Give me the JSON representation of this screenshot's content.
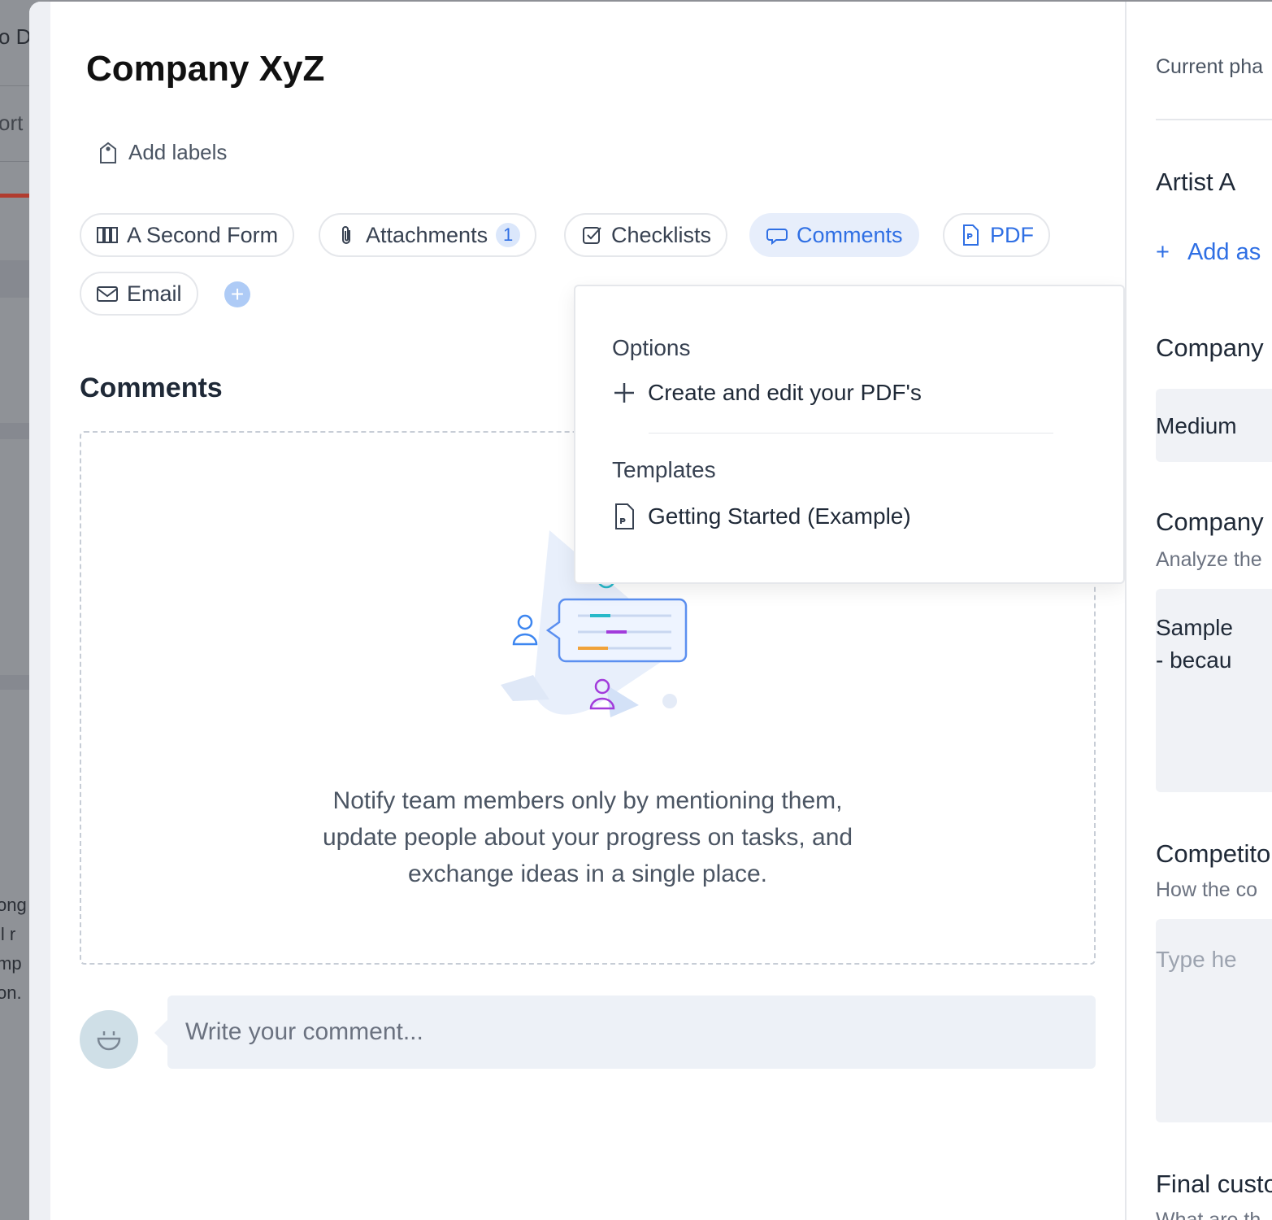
{
  "background_app": {
    "top_text": "o D",
    "second_text": "ort",
    "lines": [
      "ong",
      "ll r",
      "mp",
      "on."
    ]
  },
  "card": {
    "title": "Company XyZ",
    "add_labels": "Add labels"
  },
  "tabs": [
    {
      "label": "A Second Form",
      "icon": "form-icon"
    },
    {
      "label": "Attachments",
      "icon": "paperclip-icon",
      "badge": "1"
    },
    {
      "label": "Checklists",
      "icon": "checklist-icon"
    },
    {
      "label": "Comments",
      "icon": "comment-icon",
      "active": true
    },
    {
      "label": "PDF",
      "icon": "pdf-icon"
    },
    {
      "label": "Email",
      "icon": "email-icon"
    }
  ],
  "add_tab_icon": "plus-circle-icon",
  "comments": {
    "title": "Comments",
    "empty_lines": [
      "Notify team members only by mentioning them,",
      "update people about your progress on tasks, and",
      "exchange ideas in a single place."
    ],
    "input_placeholder": "Write your comment..."
  },
  "dropdown": {
    "options_label": "Options",
    "create_item": "Create and edit your PDF's",
    "templates_label": "Templates",
    "template_item": "Getting Started (Example)"
  },
  "right_panel": {
    "current_phase": "Current pha",
    "assignee": "Artist A",
    "add_assignee": "Add as",
    "field1_label": "Company",
    "field1_value": "Medium",
    "field2_label": "Company",
    "field2_desc": "Analyze the",
    "field2_value_line1": "Sample",
    "field2_value_line2": "- becau",
    "field3_label": "Competito",
    "field3_desc": "How the co",
    "field3_placeholder": "Type he",
    "field4_label": "Final custo",
    "field4_desc": "What are th"
  },
  "colors": {
    "accent": "#2f6fe4",
    "active_tab_bg": "#e7eefb",
    "overlay": "#8e9096"
  }
}
